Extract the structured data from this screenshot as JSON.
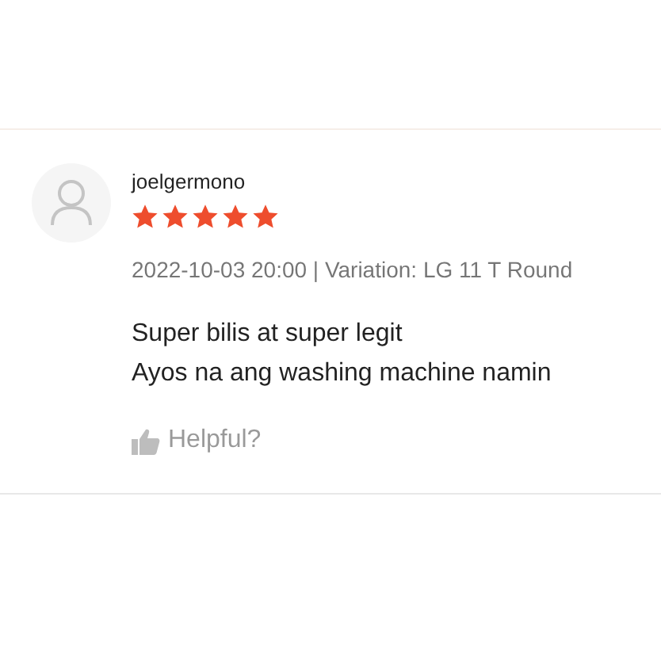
{
  "review": {
    "username": "joelgermono",
    "stars": 5,
    "meta": "2022-10-03 20:00 | Variation: LG 11 T Round",
    "comment_lines": [
      "Super bilis at super legit",
      "Ayos na ang washing machine namin"
    ],
    "helpful_label": "Helpful?"
  }
}
